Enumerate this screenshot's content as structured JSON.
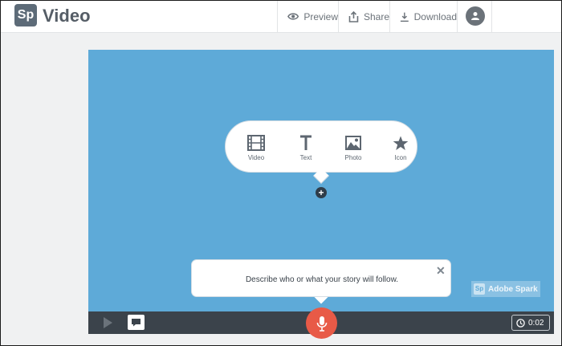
{
  "header": {
    "logo_text": "Sp",
    "app_title": "Video",
    "preview_label": "Preview",
    "share_label": "Share",
    "download_label": "Download",
    "account_icon": "user-icon"
  },
  "stage": {
    "background_color": "#5eaad8",
    "tools": [
      {
        "label": "Video",
        "icon": "film-icon"
      },
      {
        "label": "Text",
        "icon": "text-icon"
      },
      {
        "label": "Photo",
        "icon": "photo-icon"
      },
      {
        "label": "Icon",
        "icon": "star-icon"
      }
    ],
    "watermark_logo": "Sp",
    "watermark_text": "Adobe Spark"
  },
  "prompt": {
    "text": "Describe who or what your story will follow."
  },
  "controls": {
    "timer": "0:02",
    "mic_color": "#e85a47"
  }
}
